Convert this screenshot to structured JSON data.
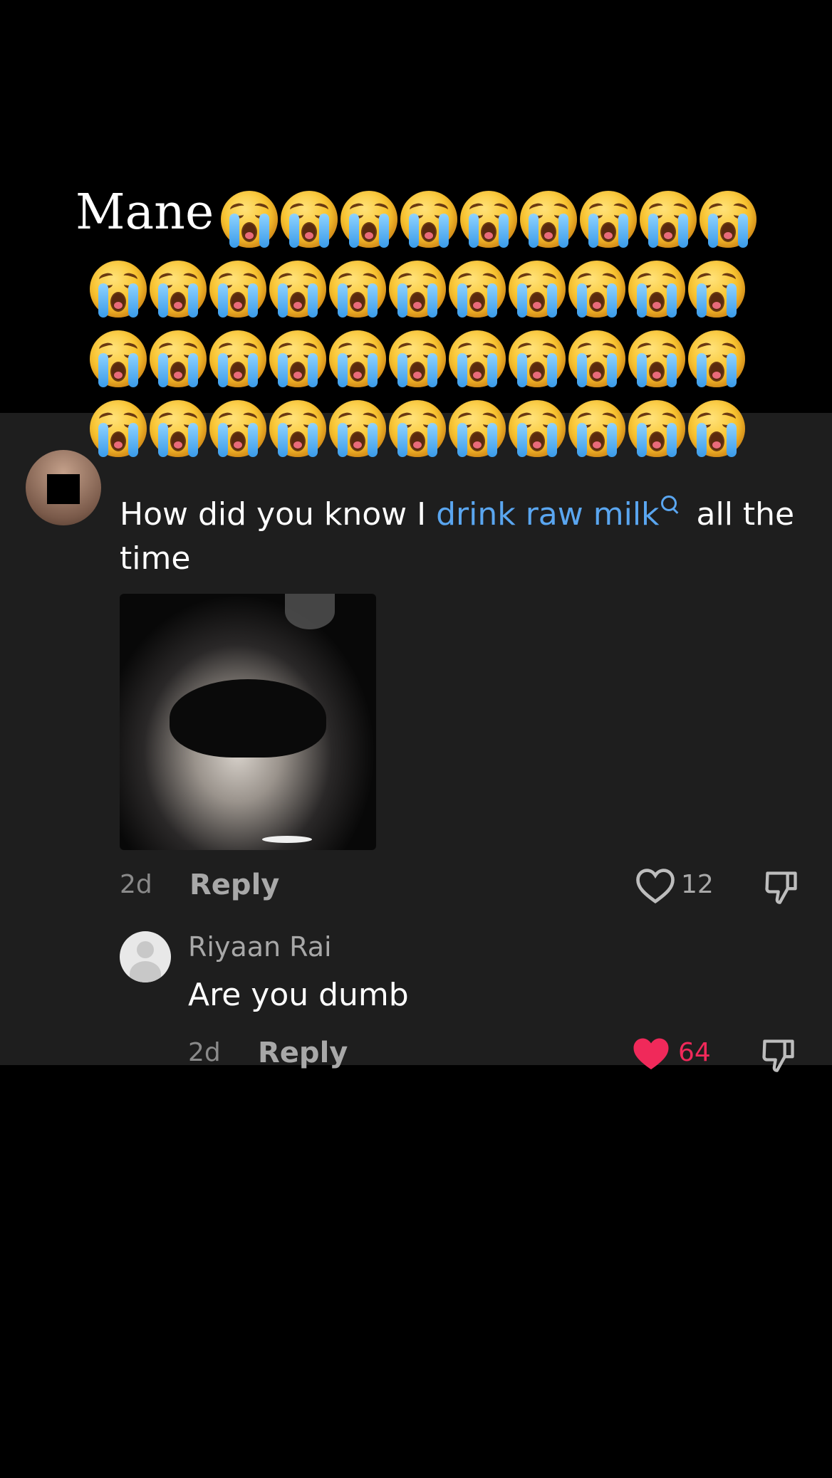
{
  "caption": {
    "word": "Mane",
    "emoji_icon": "loudly-crying-face-icon",
    "rows": [
      9,
      11,
      11,
      11
    ]
  },
  "comment": {
    "text_before": "How did you know I ",
    "hashtag": "drink raw milk",
    "text_after": " all the time",
    "time": "2d",
    "reply_label": "Reply",
    "likes": "12",
    "image_icon": "attached-photo-portrait"
  },
  "reply": {
    "username": "Riyaan Rai",
    "text": "Are you dumb",
    "time": "2d",
    "reply_label": "Reply",
    "likes": "64",
    "like_color": "#f0295a"
  }
}
